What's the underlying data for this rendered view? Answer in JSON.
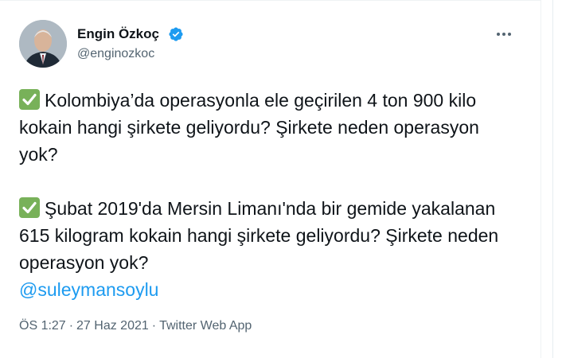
{
  "author": {
    "name": "Engin Özkoç",
    "handle": "@enginozkoc"
  },
  "tweet": {
    "para1": "Kolombiya’da operasyonla ele geçirilen 4 ton 900 kilo kokain hangi şirkete geliyordu? Şirkete neden operasyon yok?",
    "para2": "Şubat 2019'da Mersin Limanı'nda bir gemide yakalanan 615 kilogram kokain hangi şirkete geliyordu? Şirkete neden operasyon yok?",
    "mention": "@suleymansoylu"
  },
  "meta": {
    "time": "ÖS 1:27",
    "separator": "·",
    "date": "27 Haz 2021",
    "source": "Twitter Web App"
  },
  "colors": {
    "link": "#1d9bf0",
    "verified": "#1d9bf0",
    "check_emoji": "#78b159"
  },
  "icons": [
    "verified-badge-icon",
    "more-options-icon",
    "check-mark-emoji-icon"
  ]
}
